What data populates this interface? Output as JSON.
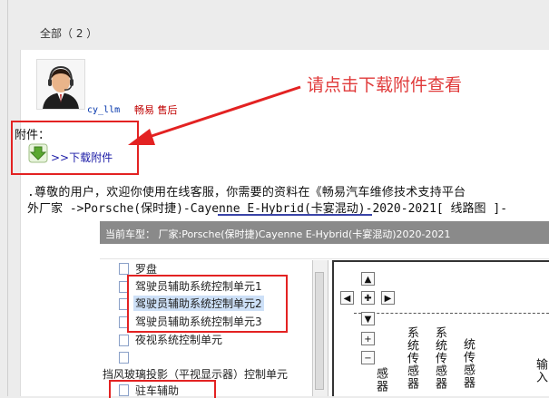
{
  "header": {
    "all_label": "全部（ 2 ）"
  },
  "post": {
    "user_name": "cy_llm",
    "service_tag": "畅易 售后",
    "hint": "请点击下载附件查看",
    "attachment_label": "附件：",
    "download_link": ">>下载附件",
    "message_line1": ".尊敬的用户，欢迎你使用在线客服，你需要的资料在《畅易汽车维修技术支持平台",
    "message_line2": "外厂家 ->Porsche(保时捷)-Cayenne E-Hybrid(卡宴混动)-2020-2021[ 线路图 ]-"
  },
  "screenshot": {
    "header": "当前车型：   厂家:Porsche(保时捷)Cayenne E-Hybrid(卡宴混动)2020-2021",
    "tree": [
      {
        "label": "罗盘"
      },
      {
        "label": "驾驶员辅助系统控制单元1"
      },
      {
        "label": "驾驶员辅助系统控制单元2"
      },
      {
        "label": "驾驶员辅助系统控制单元3"
      },
      {
        "label": "夜视系统控制单元"
      },
      {
        "label": "挡风玻璃投影（平视显示器）控制单元"
      },
      {
        "label": "驻车辅助"
      }
    ],
    "diagram_labels": [
      "感器",
      "系统传感器",
      "系统传感器",
      "统传感器",
      "输入"
    ]
  },
  "colors": {
    "annotation_red": "#e32222",
    "hint_red": "#e03a3a",
    "link_blue": "#1a1aa6"
  }
}
